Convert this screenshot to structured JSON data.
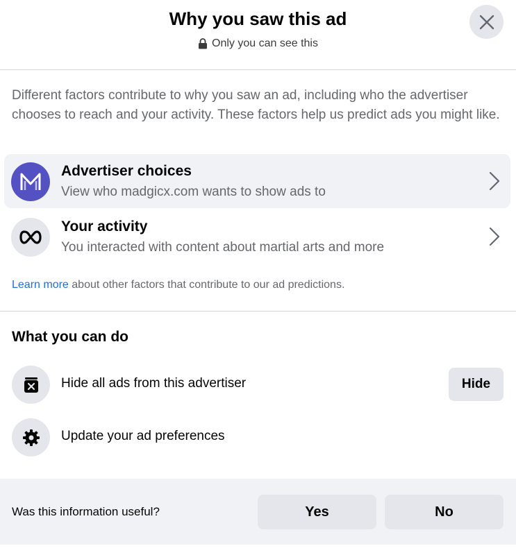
{
  "header": {
    "title": "Why you saw this ad",
    "subtitle": "Only you can see this"
  },
  "intro": "Different factors contribute to why you saw an ad, including who the advertiser chooses to reach and your activity. These factors help us predict ads you might like.",
  "factors": [
    {
      "title": "Advertiser choices",
      "subtitle": "View who madgicx.com wants to show ads to",
      "icon": "madgicx-logo-icon"
    },
    {
      "title": "Your activity",
      "subtitle": "You interacted with content about martial arts and more",
      "icon": "meta-logo-icon"
    }
  ],
  "learn_more": {
    "link": "Learn more",
    "text": " about other factors that contribute to our ad predictions."
  },
  "actions": {
    "section_title": "What you can do",
    "hide_label": "Hide all ads from this advertiser",
    "hide_button": "Hide",
    "preferences_label": "Update your ad preferences"
  },
  "feedback": {
    "question": "Was this information useful?",
    "yes": "Yes",
    "no": "No"
  },
  "colors": {
    "link": "#216fdb",
    "madgicx_brand": "#5452c2",
    "button_bg": "#e4e6eb",
    "muted_text": "#65676b"
  }
}
